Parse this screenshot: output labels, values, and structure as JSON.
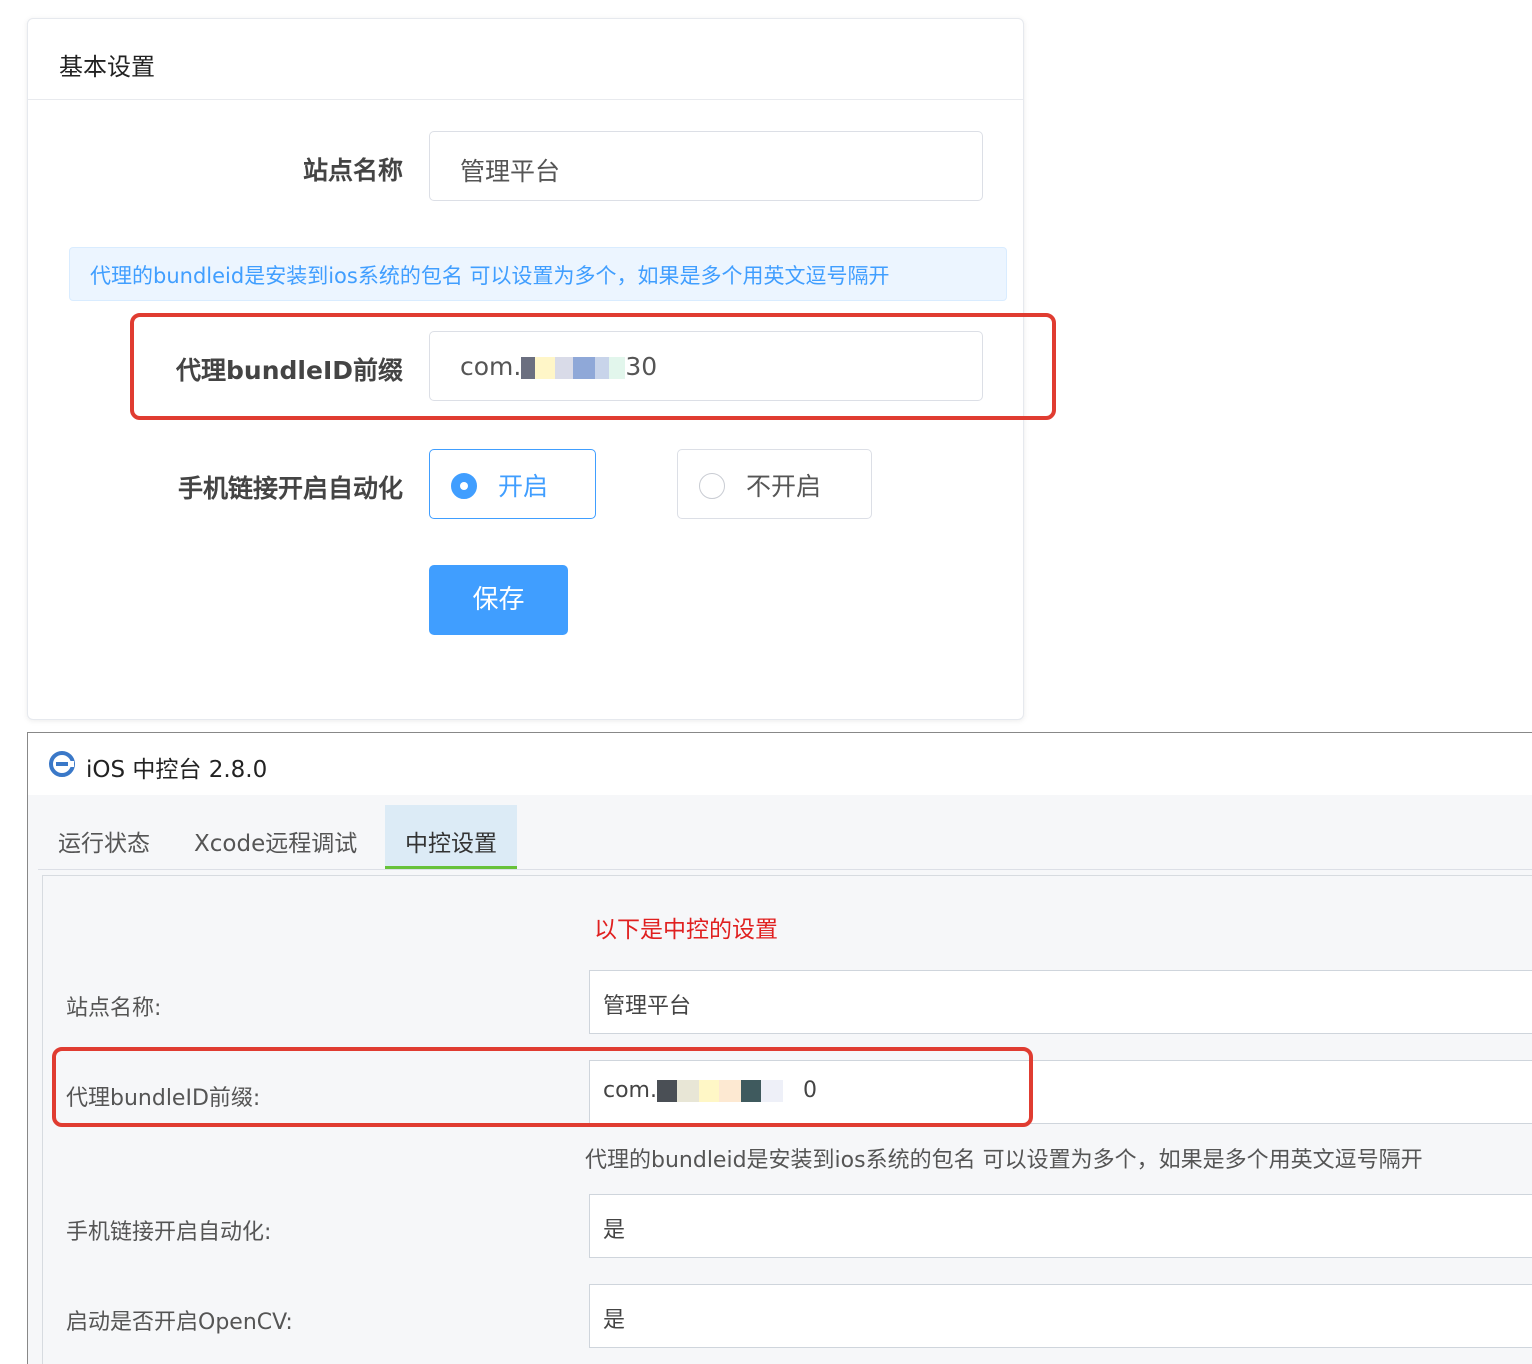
{
  "web_panel": {
    "title": "基本设置",
    "site_name": {
      "label": "站点名称",
      "value": "管理平台"
    },
    "alert": "代理的bundleid是安装到ios系统的包名 可以设置为多个，如果是多个用英文逗号隔开",
    "bundle": {
      "label": "代理bundleID前缀",
      "value_start": "com.",
      "value_end": "30"
    },
    "automation": {
      "label": "手机链接开启自动化",
      "options": [
        "开启",
        "不开启"
      ],
      "selected": "开启"
    },
    "save_label": "保存"
  },
  "app": {
    "window_title": "iOS 中控台 2.8.0",
    "tabs": [
      "运行状态",
      "Xcode远程调试",
      "中控设置"
    ],
    "active_tab": "中控设置",
    "section_title": "以下是中控的设置",
    "site_name": {
      "label": "站点名称:",
      "value": "管理平台"
    },
    "bundle": {
      "label": "代理bundleID前缀:",
      "value_start": "com.",
      "value_end": "0"
    },
    "bundle_hint": "代理的bundleid是安装到ios系统的包名 可以设置为多个，如果是多个用英文逗号隔开",
    "automation": {
      "label": "手机链接开启自动化:",
      "value": "是"
    },
    "opencv": {
      "label": "启动是否开启OpenCV:",
      "value": "是"
    }
  },
  "colors": {
    "primary": "#409eff",
    "highlight_box": "#e03c31",
    "section_title": "#e02020",
    "active_tab_underline": "#67c23a"
  },
  "icons": {
    "app": "app-logo-icon",
    "radio_on": "radio-checked-icon",
    "radio_off": "radio-unchecked-icon"
  }
}
